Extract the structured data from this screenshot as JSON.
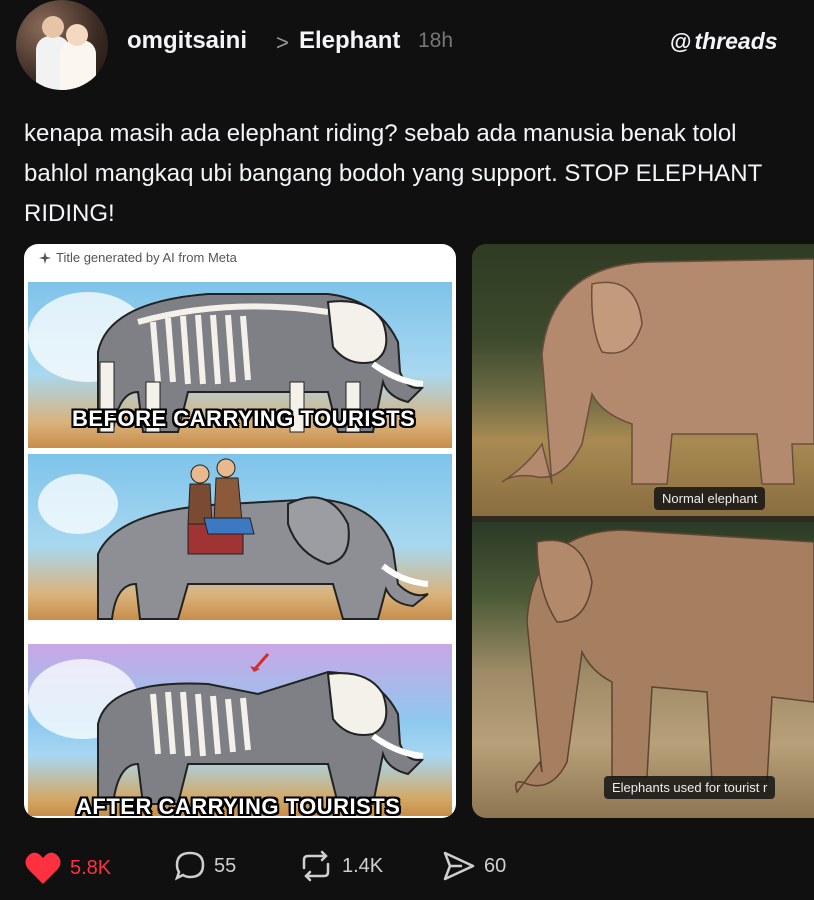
{
  "post": {
    "username": "omgitsaini",
    "topic": "Elephant",
    "time": "18h",
    "brand": "threads",
    "brand_mark": "@",
    "separator": ">",
    "text": "kenapa masih ada elephant riding? sebab ada manusia benak tolol bahlol mangkaq ubi bangang bodoh yang support. STOP ELEPHANT RIDING!"
  },
  "media": {
    "ai_label": "Title generated by AI from Meta",
    "panel_captions": [
      "BEFORE CARRYING TOURISTS",
      "AFTER CARRYING TOURISTS"
    ],
    "photo_captions": [
      "Normal elephant",
      "Elephants used for tourist r"
    ]
  },
  "actions": {
    "likes": "5.8K",
    "comments": "55",
    "reposts": "1.4K",
    "shares": "60"
  },
  "colors": {
    "background": "#101010",
    "like_red": "#ff3040",
    "text": "#f3f5f7",
    "muted": "#777777"
  },
  "icons": [
    "heart-icon",
    "comment-icon",
    "repost-icon",
    "share-icon",
    "threads-logo-icon",
    "sparkle-icon"
  ]
}
